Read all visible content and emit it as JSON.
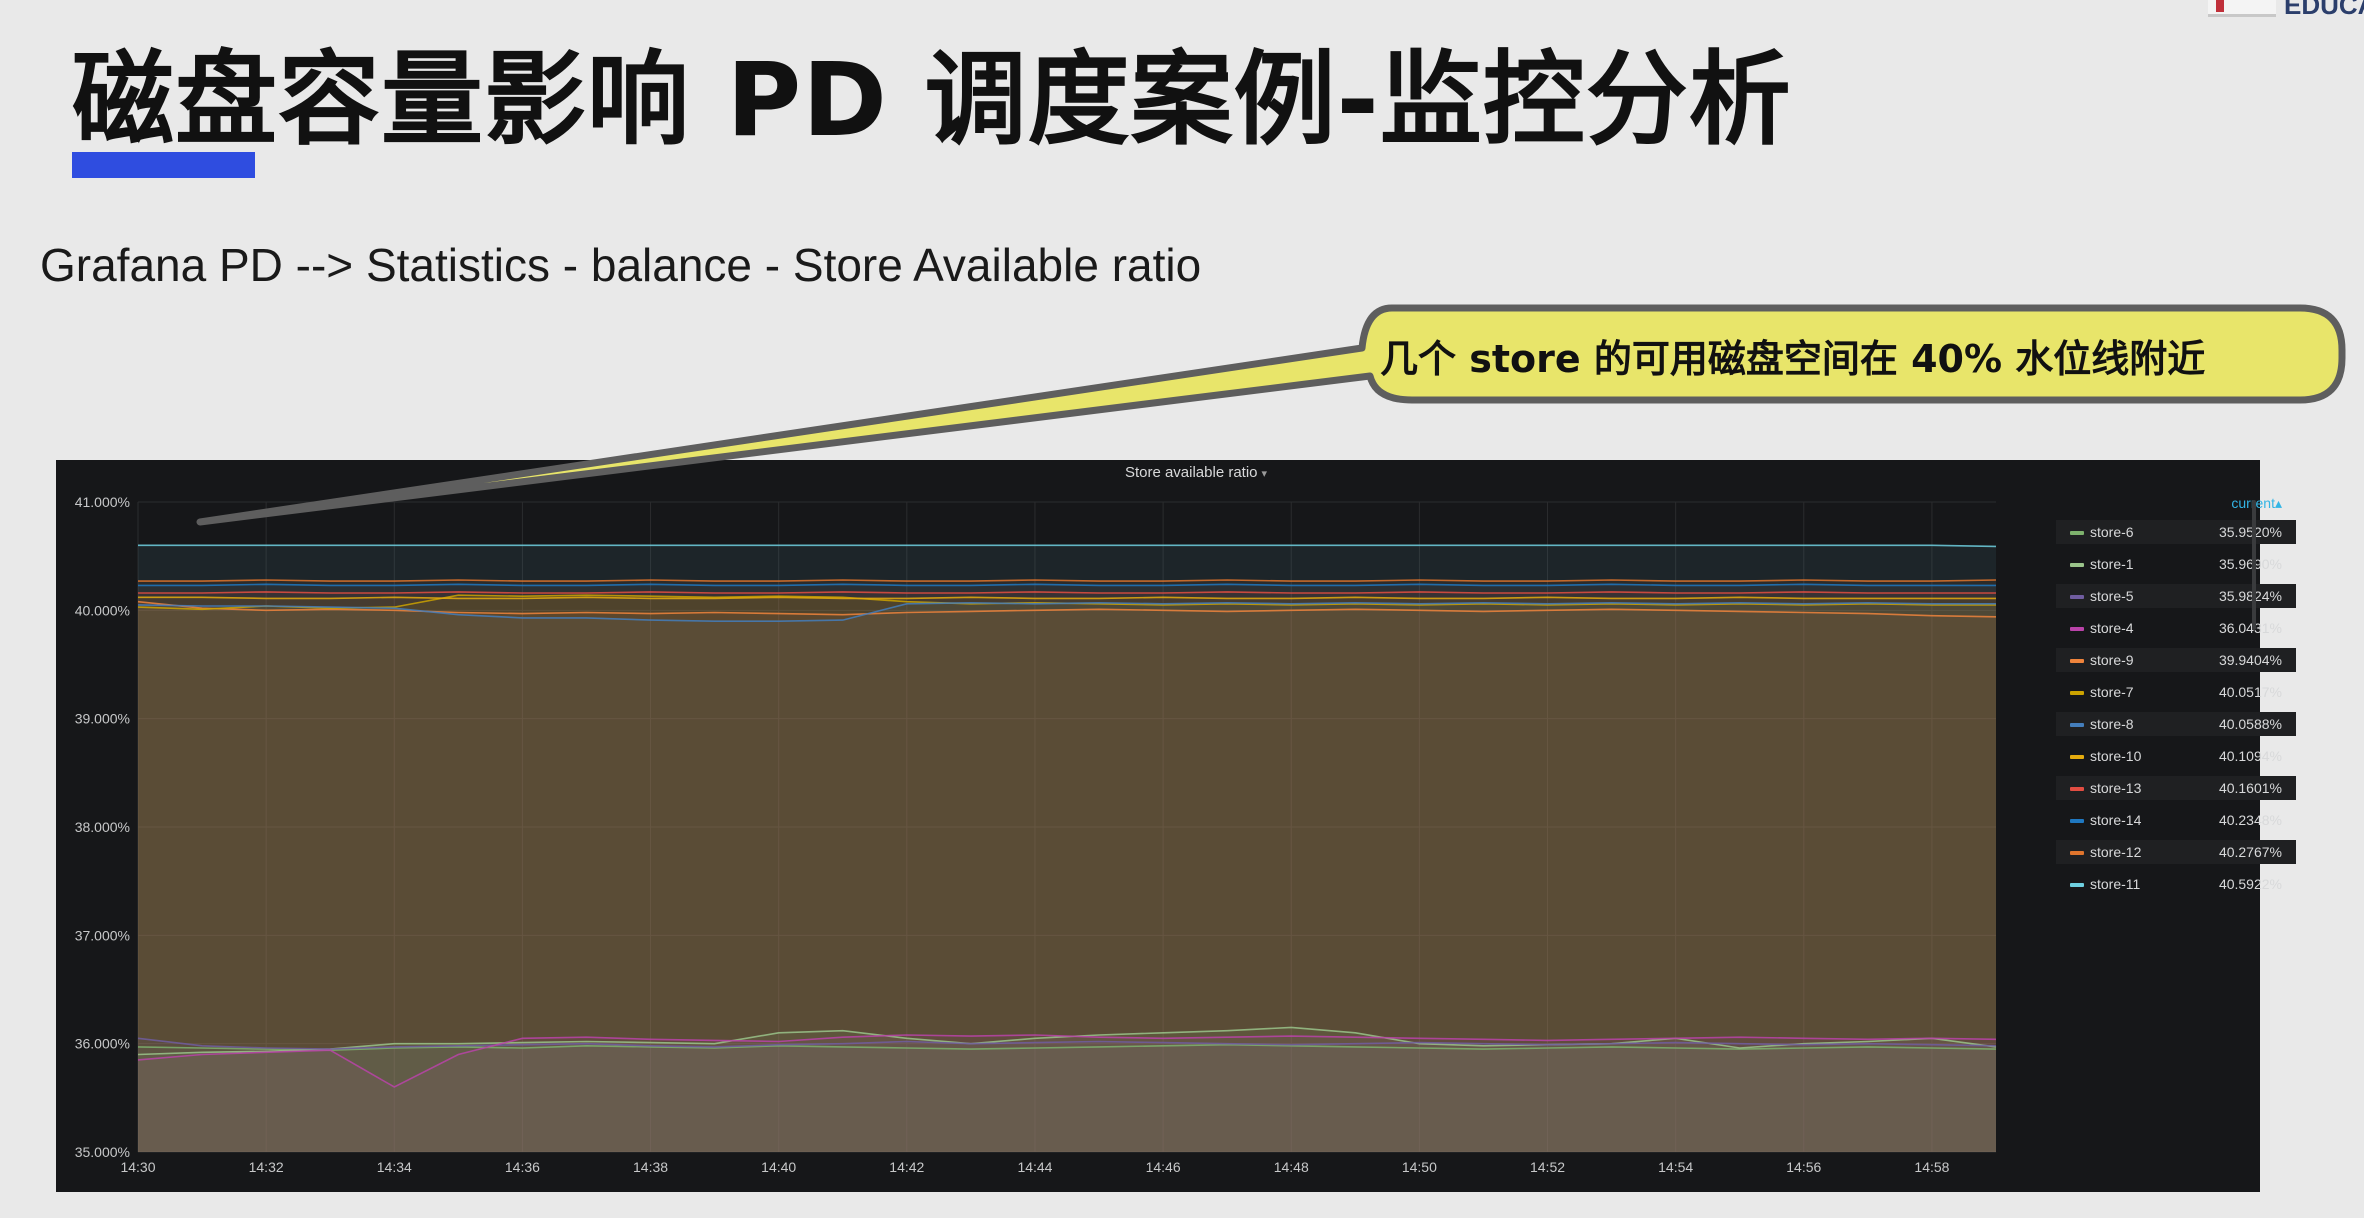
{
  "slide": {
    "title": "磁盘容量影响 PD 调度案例-监控分析",
    "subtitle": "Grafana PD --> Statistics - balance - Store Available ratio",
    "accent_color": "#2f4de0",
    "logo_text": "EDUCA"
  },
  "callout": {
    "text": "几个 store 的可用磁盘空间在 40% 水位线附近",
    "fill_color": "#e8e56a"
  },
  "panel": {
    "title": "Store available ratio",
    "caret": "▾"
  },
  "chart_data": {
    "type": "area",
    "title": "Store available ratio",
    "x": [
      "14:30",
      "14:31",
      "14:32",
      "14:33",
      "14:34",
      "14:35",
      "14:36",
      "14:37",
      "14:38",
      "14:39",
      "14:40",
      "14:41",
      "14:42",
      "14:43",
      "14:44",
      "14:45",
      "14:46",
      "14:47",
      "14:48",
      "14:49",
      "14:50",
      "14:51",
      "14:52",
      "14:53",
      "14:54",
      "14:55",
      "14:56",
      "14:57",
      "14:58",
      "14:59"
    ],
    "x_tick_labels": [
      "14:30",
      "14:32",
      "14:34",
      "14:36",
      "14:38",
      "14:40",
      "14:42",
      "14:44",
      "14:46",
      "14:48",
      "14:50",
      "14:52",
      "14:54",
      "14:56",
      "14:58"
    ],
    "ylim": [
      35,
      41
    ],
    "y_ticks": [
      35,
      36,
      37,
      38,
      39,
      40,
      41
    ],
    "y_tick_labels": [
      "35.000%",
      "36.000%",
      "37.000%",
      "38.000%",
      "39.000%",
      "40.000%",
      "41.000%"
    ],
    "grid": true,
    "legend_position": "right",
    "legend_header": "current",
    "legend_sort_indicator": "▴",
    "series": [
      {
        "name": "store-6",
        "current": "35.9520%",
        "color": "#7eb26d",
        "values": [
          35.97,
          35.96,
          35.95,
          35.94,
          35.96,
          35.97,
          35.96,
          35.98,
          35.97,
          35.96,
          35.98,
          35.97,
          35.96,
          35.95,
          35.96,
          35.97,
          35.98,
          35.99,
          35.98,
          35.97,
          35.96,
          35.95,
          35.96,
          35.97,
          35.96,
          35.95,
          35.96,
          35.97,
          35.96,
          35.95
        ]
      },
      {
        "name": "store-1",
        "current": "35.9690%",
        "color": "#9ac48a",
        "values": [
          35.9,
          35.92,
          35.93,
          35.95,
          36.0,
          36.0,
          36.01,
          36.02,
          36.01,
          36.0,
          36.1,
          36.12,
          36.05,
          36.0,
          36.05,
          36.08,
          36.1,
          36.12,
          36.15,
          36.1,
          36.0,
          35.98,
          35.99,
          36.0,
          36.05,
          35.96,
          36.0,
          36.02,
          36.05,
          35.97
        ]
      },
      {
        "name": "store-5",
        "current": "35.9824%",
        "color": "#705da0",
        "values": [
          36.05,
          35.98,
          35.96,
          35.95,
          35.97,
          35.98,
          35.99,
          36.0,
          35.98,
          35.97,
          35.99,
          36.0,
          36.02,
          36.0,
          36.01,
          36.02,
          36.01,
          36.0,
          35.99,
          36.0,
          36.01,
          36.0,
          35.99,
          36.0,
          36.01,
          36.0,
          35.99,
          36.0,
          35.99,
          35.98
        ]
      },
      {
        "name": "store-4",
        "current": "36.0431%",
        "color": "#ba43a9",
        "values": [
          35.85,
          35.9,
          35.92,
          35.94,
          35.6,
          35.9,
          36.05,
          36.06,
          36.04,
          36.03,
          36.02,
          36.06,
          36.08,
          36.07,
          36.08,
          36.06,
          36.05,
          36.06,
          36.07,
          36.06,
          36.05,
          36.04,
          36.03,
          36.04,
          36.05,
          36.06,
          36.05,
          36.04,
          36.05,
          36.04
        ]
      },
      {
        "name": "store-9",
        "current": "39.9404%",
        "color": "#ef843c",
        "values": [
          40.08,
          40.02,
          40.0,
          40.01,
          40.0,
          39.98,
          39.97,
          39.98,
          39.97,
          39.98,
          39.97,
          39.96,
          39.98,
          39.99,
          40.0,
          40.01,
          40.0,
          39.99,
          40.0,
          40.01,
          40.0,
          39.99,
          40.0,
          40.01,
          40.0,
          39.99,
          39.98,
          39.97,
          39.95,
          39.94
        ]
      },
      {
        "name": "store-7",
        "current": "40.0517%",
        "color": "#cca300",
        "values": [
          40.03,
          40.01,
          40.04,
          40.02,
          40.03,
          40.14,
          40.13,
          40.14,
          40.13,
          40.12,
          40.13,
          40.12,
          40.08,
          40.06,
          40.07,
          40.06,
          40.05,
          40.06,
          40.05,
          40.06,
          40.05,
          40.06,
          40.05,
          40.06,
          40.05,
          40.06,
          40.05,
          40.06,
          40.05,
          40.05
        ]
      },
      {
        "name": "store-8",
        "current": "40.0588%",
        "color": "#447ebc",
        "values": [
          40.05,
          40.04,
          40.04,
          40.03,
          40.02,
          39.96,
          39.93,
          39.93,
          39.91,
          39.9,
          39.9,
          39.91,
          40.06,
          40.07,
          40.06,
          40.07,
          40.06,
          40.07,
          40.06,
          40.07,
          40.06,
          40.07,
          40.06,
          40.07,
          40.06,
          40.07,
          40.06,
          40.07,
          40.06,
          40.06
        ]
      },
      {
        "name": "store-10",
        "current": "40.1094%",
        "color": "#e5ac0e",
        "values": [
          40.12,
          40.12,
          40.11,
          40.11,
          40.12,
          40.11,
          40.11,
          40.12,
          40.11,
          40.11,
          40.12,
          40.11,
          40.11,
          40.12,
          40.11,
          40.11,
          40.12,
          40.11,
          40.11,
          40.12,
          40.11,
          40.11,
          40.12,
          40.11,
          40.11,
          40.12,
          40.11,
          40.11,
          40.11,
          40.11
        ]
      },
      {
        "name": "store-13",
        "current": "40.1601%",
        "color": "#e24d42",
        "values": [
          40.16,
          40.16,
          40.17,
          40.16,
          40.16,
          40.17,
          40.16,
          40.16,
          40.17,
          40.16,
          40.16,
          40.17,
          40.16,
          40.16,
          40.17,
          40.16,
          40.16,
          40.17,
          40.16,
          40.16,
          40.17,
          40.16,
          40.16,
          40.17,
          40.16,
          40.16,
          40.17,
          40.16,
          40.16,
          40.16
        ]
      },
      {
        "name": "store-14",
        "current": "40.2348%",
        "color": "#1f78c1",
        "values": [
          40.23,
          40.23,
          40.24,
          40.23,
          40.23,
          40.24,
          40.23,
          40.23,
          40.24,
          40.23,
          40.23,
          40.24,
          40.23,
          40.23,
          40.24,
          40.23,
          40.23,
          40.24,
          40.23,
          40.23,
          40.24,
          40.23,
          40.23,
          40.24,
          40.23,
          40.23,
          40.24,
          40.23,
          40.23,
          40.23
        ]
      },
      {
        "name": "store-12",
        "current": "40.2767%",
        "color": "#e0752d",
        "values": [
          40.27,
          40.27,
          40.28,
          40.27,
          40.27,
          40.28,
          40.27,
          40.27,
          40.28,
          40.27,
          40.27,
          40.28,
          40.27,
          40.27,
          40.28,
          40.27,
          40.27,
          40.28,
          40.27,
          40.27,
          40.28,
          40.27,
          40.27,
          40.28,
          40.27,
          40.27,
          40.28,
          40.27,
          40.27,
          40.28
        ]
      },
      {
        "name": "store-11",
        "current": "40.5922%",
        "color": "#6ed0e0",
        "values": [
          40.6,
          40.6,
          40.6,
          40.6,
          40.6,
          40.6,
          40.6,
          40.6,
          40.6,
          40.6,
          40.6,
          40.6,
          40.6,
          40.6,
          40.6,
          40.6,
          40.6,
          40.6,
          40.6,
          40.6,
          40.6,
          40.6,
          40.6,
          40.6,
          40.6,
          40.6,
          40.6,
          40.6,
          40.6,
          40.59
        ]
      }
    ]
  }
}
